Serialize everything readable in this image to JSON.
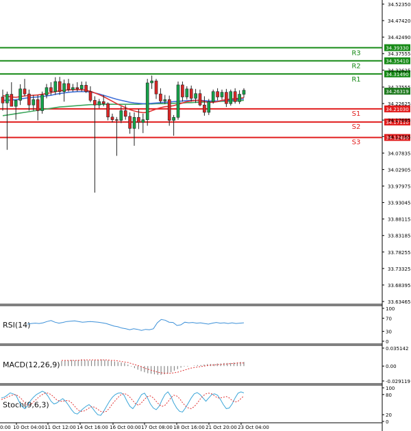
{
  "colors": {
    "up": "#16a34a",
    "down": "#dc2626",
    "resistance": "#168a16",
    "support": "#e11d1d",
    "ma_fast": "#e03030",
    "ma_mid": "#3f6fd8",
    "ma_slow": "#3aa55a",
    "rsi": "#3a8fd8",
    "macd_signal": "#e03030",
    "macd_hist": "#888888",
    "stoch_k": "#3aa5d8",
    "stoch_d": "#e03030",
    "price_box": "#1f7a1f",
    "price_text": "#ffffff"
  },
  "chart_data": {
    "type": "candlestick",
    "title": "",
    "x_tick_labels": [
      "10 Oct 04:00",
      "11 Oct 12:00",
      "14 Oct 16:00",
      "16 Oct 00:00",
      "17 Oct 08:00",
      "18 Oct 16:00",
      "21 Oct 20:00",
      "23 Oct 04:00"
    ],
    "x_tick_partial": "0:00",
    "y_tick_labels": [
      "34.52350",
      "34.47420",
      "34.42490",
      "34.37555",
      "34.32625",
      "34.27555",
      "34.22625",
      "34.17695",
      "34.12765",
      "34.07835",
      "34.02905",
      "33.97975",
      "33.93045",
      "33.88115",
      "33.83185",
      "33.78255",
      "33.73325",
      "33.68395",
      "33.63465"
    ],
    "y_range": [
      33.63465,
      34.5235
    ],
    "last_price": "34.26319",
    "levels": [
      {
        "name": "R3",
        "value": 34.3933,
        "label": "34.39330",
        "kind": "resistance"
      },
      {
        "name": "R2",
        "value": 34.3541,
        "label": "34.35410",
        "kind": "resistance"
      },
      {
        "name": "R1",
        "value": 34.3149,
        "label": "34.31490",
        "kind": "resistance"
      },
      {
        "name": "S1",
        "value": 34.2103,
        "label": "34.21030",
        "kind": "support"
      },
      {
        "name": "S2",
        "value": 34.1711,
        "label": "34.17110",
        "kind": "support"
      },
      {
        "name": "S3",
        "value": 34.1249,
        "label": "34.12490",
        "kind": "support"
      }
    ],
    "candles": [
      [
        34.246,
        34.268,
        34.205,
        34.228
      ],
      [
        34.228,
        34.262,
        34.088,
        34.254
      ],
      [
        34.254,
        34.29,
        34.235,
        34.218
      ],
      [
        34.218,
        34.234,
        34.178,
        34.236
      ],
      [
        34.236,
        34.284,
        34.222,
        34.27
      ],
      [
        34.27,
        34.3,
        34.248,
        34.255
      ],
      [
        34.255,
        34.268,
        34.205,
        34.222
      ],
      [
        34.222,
        34.252,
        34.205,
        34.238
      ],
      [
        34.238,
        34.252,
        34.176,
        34.205
      ],
      [
        34.205,
        34.262,
        34.196,
        34.252
      ],
      [
        34.252,
        34.285,
        34.242,
        34.274
      ],
      [
        34.274,
        34.29,
        34.252,
        34.262
      ],
      [
        34.262,
        34.305,
        34.252,
        34.292
      ],
      [
        34.292,
        34.306,
        34.252,
        34.262
      ],
      [
        34.262,
        34.298,
        34.232,
        34.286
      ],
      [
        34.286,
        34.3,
        34.262,
        34.268
      ],
      [
        34.268,
        34.285,
        34.262,
        34.274
      ],
      [
        34.274,
        34.29,
        34.262,
        34.27
      ],
      [
        34.27,
        34.292,
        34.262,
        34.281
      ],
      [
        34.281,
        34.292,
        34.258,
        34.262
      ],
      [
        34.262,
        34.278,
        34.23,
        34.236
      ],
      [
        34.236,
        34.248,
        33.96,
        34.222
      ],
      [
        34.222,
        34.24,
        34.212,
        34.232
      ],
      [
        34.232,
        34.252,
        34.218,
        34.226
      ],
      [
        34.226,
        34.23,
        34.176,
        34.186
      ],
      [
        34.186,
        34.196,
        34.17,
        34.178
      ],
      [
        34.178,
        34.186,
        34.07,
        34.176
      ],
      [
        34.176,
        34.218,
        34.168,
        34.205
      ],
      [
        34.205,
        34.222,
        34.178,
        34.188
      ],
      [
        34.188,
        34.2,
        34.136,
        34.152
      ],
      [
        34.152,
        34.2,
        34.1,
        34.185
      ],
      [
        34.185,
        34.21,
        34.15,
        34.17
      ],
      [
        34.17,
        34.196,
        34.138,
        34.178
      ],
      [
        34.178,
        34.3,
        34.16,
        34.288
      ],
      [
        34.288,
        34.31,
        34.27,
        34.294
      ],
      [
        34.294,
        34.3,
        34.24,
        34.255
      ],
      [
        34.255,
        34.272,
        34.228,
        34.234
      ],
      [
        34.234,
        34.252,
        34.225,
        34.238
      ],
      [
        34.238,
        34.25,
        34.16,
        34.176
      ],
      [
        34.176,
        34.192,
        34.13,
        34.185
      ],
      [
        34.185,
        34.292,
        34.178,
        34.282
      ],
      [
        34.282,
        34.292,
        34.232,
        34.246
      ],
      [
        34.246,
        34.278,
        34.238,
        34.27
      ],
      [
        34.27,
        34.28,
        34.232,
        34.242
      ],
      [
        34.242,
        34.27,
        34.228,
        34.256
      ],
      [
        34.256,
        34.268,
        34.218,
        34.222
      ],
      [
        34.222,
        34.248,
        34.19,
        34.2
      ],
      [
        34.2,
        34.24,
        34.192,
        34.232
      ],
      [
        34.232,
        34.268,
        34.226,
        34.262
      ],
      [
        34.262,
        34.272,
        34.236,
        34.246
      ],
      [
        34.246,
        34.268,
        34.238,
        34.26
      ],
      [
        34.26,
        34.27,
        34.216,
        34.226
      ],
      [
        34.226,
        34.268,
        34.22,
        34.262
      ],
      [
        34.262,
        34.272,
        34.226,
        34.232
      ],
      [
        34.232,
        34.266,
        34.225,
        34.254
      ],
      [
        34.254,
        34.272,
        34.244,
        34.266
      ]
    ],
    "ma_fast": [
      34.25,
      34.248,
      34.246,
      34.245,
      34.247,
      34.249,
      34.25,
      34.251,
      34.252,
      34.254,
      34.256,
      34.259,
      34.262,
      34.264,
      34.266,
      34.267,
      34.268,
      34.268,
      34.268,
      34.266,
      34.263,
      34.258,
      34.253,
      34.247,
      34.24,
      34.233,
      34.226,
      34.22,
      34.214,
      34.208,
      34.204,
      34.201,
      34.199,
      34.2,
      34.205,
      34.21,
      34.214,
      34.217,
      34.218,
      34.22,
      34.224,
      34.228,
      34.232,
      34.234,
      34.236,
      34.236,
      34.232,
      34.23,
      34.23,
      34.232,
      34.236,
      34.238,
      34.24,
      34.241,
      34.242,
      34.244
    ],
    "ma_mid": [
      34.236,
      34.236,
      34.237,
      34.238,
      34.24,
      34.242,
      34.244,
      34.245,
      34.246,
      34.247,
      34.249,
      34.251,
      34.254,
      34.256,
      34.258,
      34.26,
      34.261,
      34.262,
      34.262,
      34.262,
      34.261,
      34.258,
      34.255,
      34.251,
      34.247,
      34.243,
      34.239,
      34.236,
      34.233,
      34.23,
      34.228,
      34.227,
      34.226,
      34.226,
      34.227,
      34.228,
      34.229,
      34.23,
      34.231,
      34.232,
      34.233,
      34.234,
      34.235,
      34.236,
      34.236,
      34.236,
      34.235,
      34.234,
      34.234,
      34.234,
      34.235,
      34.236,
      34.237,
      34.238,
      34.239,
      34.24
    ],
    "ma_slow": [
      34.19,
      34.192,
      34.194,
      34.196,
      34.198,
      34.2,
      34.202,
      34.204,
      34.206,
      34.208,
      34.21,
      34.212,
      34.214,
      34.216,
      34.217,
      34.218,
      34.219,
      34.22,
      34.221,
      34.222,
      34.223,
      34.223,
      34.224,
      34.224,
      34.224,
      34.224,
      34.224,
      34.224,
      34.224,
      34.224,
      34.224,
      34.224,
      34.225,
      34.225,
      34.225,
      34.226,
      34.226,
      34.226,
      34.227,
      34.227,
      34.228,
      34.228,
      34.229,
      34.229,
      34.23,
      34.23,
      34.231,
      34.231,
      34.232,
      34.232,
      34.233,
      34.233,
      34.234,
      34.234,
      34.235,
      34.236
    ],
    "rsi": {
      "label": "RSI(14)",
      "ticks": [
        "100",
        "70",
        "30",
        "0"
      ],
      "range": [
        0,
        100
      ],
      "values": [
        52,
        54,
        55,
        54,
        56,
        60,
        63,
        58,
        55,
        57,
        60,
        61,
        62,
        60,
        58,
        59,
        60,
        59,
        58,
        56,
        54,
        50,
        46,
        44,
        40,
        38,
        35,
        38,
        36,
        33,
        36,
        35,
        38,
        56,
        66,
        64,
        58,
        57,
        48,
        50,
        58,
        56,
        57,
        55,
        56,
        54,
        52,
        55,
        57,
        55,
        56,
        54,
        56,
        54,
        55,
        56
      ]
    },
    "macd": {
      "label": "MACD(12,26,9)",
      "ticks": [
        "0.035142",
        "0.00",
        "-0.029119"
      ],
      "range": [
        -0.029119,
        0.035142
      ],
      "hist": [
        0.01,
        0.011,
        0.011,
        0.012,
        0.011,
        0.012,
        0.013,
        0.012,
        0.011,
        0.011,
        0.012,
        0.012,
        0.013,
        0.012,
        0.011,
        0.01,
        0.009,
        0.008,
        0.007,
        0.006,
        0.003,
        -0.001,
        -0.004,
        -0.007,
        -0.01,
        -0.012,
        -0.014,
        -0.015,
        -0.016,
        -0.017,
        -0.017,
        -0.016,
        -0.015,
        -0.012,
        -0.009,
        -0.006,
        -0.003,
        -0.001,
        -0.001,
        0.0,
        0.001,
        0.002,
        0.002,
        0.003,
        0.004,
        0.004,
        0.004,
        0.005,
        0.005,
        0.006,
        0.006,
        0.006,
        0.007,
        0.007,
        0.008,
        0.008
      ],
      "signal": [
        0.011,
        0.011,
        0.011,
        0.011,
        0.011,
        0.011,
        0.012,
        0.012,
        0.012,
        0.012,
        0.012,
        0.012,
        0.012,
        0.012,
        0.012,
        0.011,
        0.011,
        0.01,
        0.009,
        0.008,
        0.007,
        0.005,
        0.003,
        0.001,
        -0.001,
        -0.004,
        -0.006,
        -0.008,
        -0.01,
        -0.012,
        -0.013,
        -0.014,
        -0.014,
        -0.014,
        -0.013,
        -0.012,
        -0.01,
        -0.008,
        -0.006,
        -0.004,
        -0.003,
        -0.002,
        -0.001,
        0.0,
        0.001,
        0.002,
        0.002,
        0.003,
        0.003,
        0.004,
        0.004,
        0.005,
        0.005,
        0.006,
        0.006,
        0.006
      ]
    },
    "stoch": {
      "label": "Stoch(9,6,3)",
      "ticks": [
        "100",
        "80",
        "20",
        "0"
      ],
      "range": [
        0,
        100
      ],
      "k": [
        70,
        72,
        78,
        85,
        82,
        78,
        60,
        45,
        38,
        48,
        62,
        72,
        80,
        85,
        90,
        86,
        75,
        60,
        52,
        55,
        62,
        68,
        60,
        48,
        35,
        25,
        22,
        30,
        38,
        45,
        50,
        42,
        30,
        20,
        18,
        30,
        45,
        60,
        72,
        80,
        84,
        85,
        78,
        60,
        45,
        38,
        50,
        66,
        80,
        84,
        70,
        52,
        40,
        35,
        45,
        64,
        80,
        88,
        75,
        55,
        40,
        30,
        28,
        40,
        55,
        70,
        82,
        86,
        80,
        70,
        60,
        70,
        80,
        82,
        78,
        65,
        50,
        38,
        40,
        52,
        70,
        84,
        88,
        85
      ],
      "d": [
        65,
        68,
        72,
        76,
        79,
        80,
        74,
        66,
        55,
        48,
        50,
        58,
        66,
        74,
        80,
        84,
        84,
        80,
        72,
        64,
        60,
        60,
        62,
        62,
        56,
        46,
        36,
        30,
        30,
        34,
        40,
        44,
        42,
        36,
        30,
        28,
        30,
        40,
        52,
        62,
        72,
        80,
        83,
        80,
        72,
        62,
        52,
        48,
        56,
        66,
        74,
        76,
        70,
        60,
        50,
        45,
        48,
        58,
        70,
        78,
        76,
        68,
        56,
        46,
        40,
        38,
        44,
        54,
        66,
        76,
        82,
        84,
        82,
        76,
        70,
        70,
        72,
        74,
        70,
        62,
        58,
        60,
        68,
        76
      ]
    }
  }
}
